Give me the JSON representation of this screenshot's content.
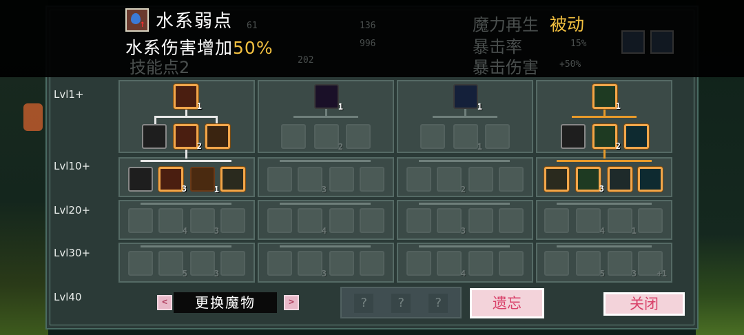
{
  "tooltip": {
    "title": "水系弱点",
    "desc_prefix": "水系伤害增加",
    "desc_highlight": "50%",
    "tag": "被动"
  },
  "stats_ghost": {
    "stat1": "61",
    "stat2": "136",
    "stat3": "996",
    "stat4": "202",
    "skill_points_label": "技能点2",
    "mana_regen_label": "魔力再生",
    "crit_rate_label": "暴击率",
    "crit_rate_value": "15%",
    "crit_dmg_label": "暴击伤害",
    "crit_dmg_value": "+50%"
  },
  "levels": [
    "Lvl1+",
    "Lvl10+",
    "Lvl20+",
    "Lvl30+",
    "Lvl40"
  ],
  "tree": {
    "col1": {
      "top": "1",
      "mid": "2",
      "row2": "3",
      "row2b": "1",
      "row3a": "4",
      "row3b": "3",
      "row4a": "5",
      "row4b": "3"
    },
    "col2": {
      "top": "1",
      "mid": "2",
      "row2": "3",
      "row3": "4",
      "row4": "3"
    },
    "col3": {
      "top": "1",
      "mid": "1",
      "row2": "2",
      "row3": "3",
      "row4": "4"
    },
    "col4": {
      "top": "1",
      "mid": "2",
      "row2": "3",
      "row3a": "4",
      "row3b": "1",
      "row4a": "5",
      "row4b": "3",
      "row4c": "+1"
    }
  },
  "bottom": {
    "prev": "<",
    "next": ">",
    "swap_label": "更换魔物",
    "slots": [
      "?",
      "?",
      "?"
    ],
    "forget_label": "遗忘",
    "close_label": "关闭"
  }
}
